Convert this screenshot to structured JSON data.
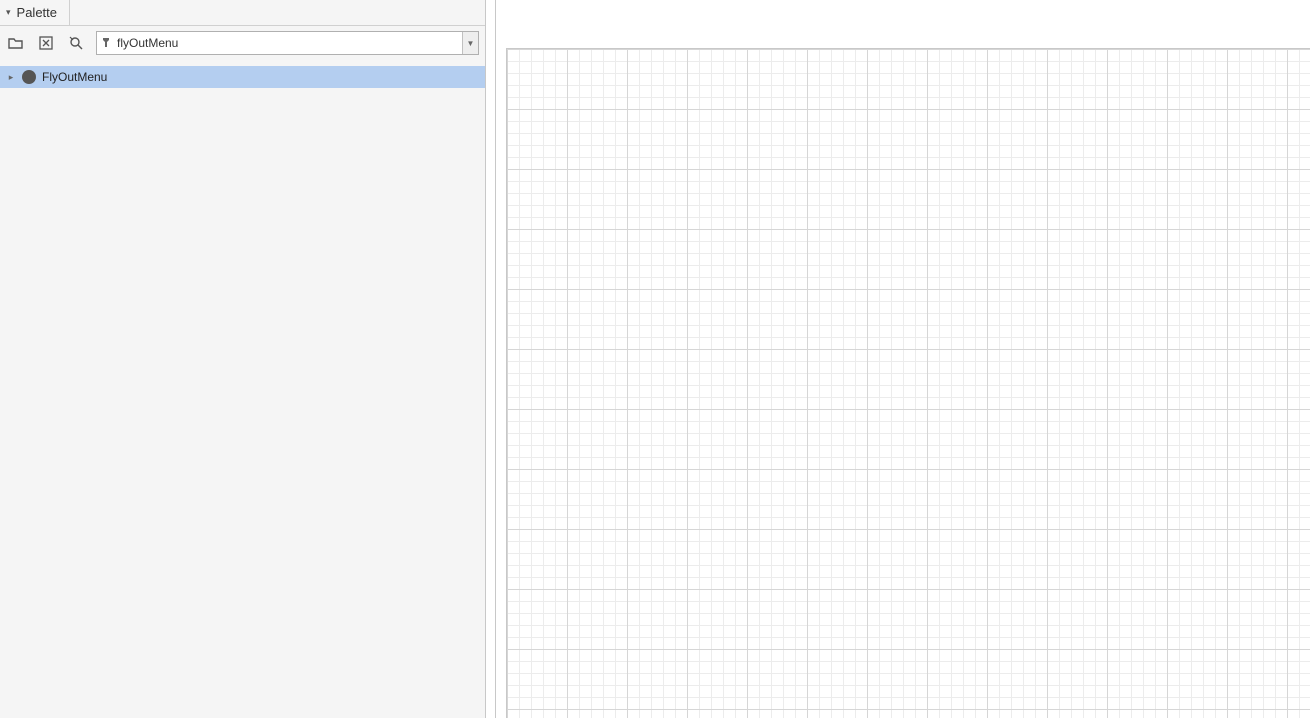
{
  "palette": {
    "tab_label": "Palette",
    "search_value": "flyOutMenu",
    "items": [
      {
        "label": "FlyOutMenu",
        "selected": true
      }
    ]
  },
  "icons": {
    "folder_open": "folder-open-icon",
    "clear": "clear-icon",
    "locate": "locate-icon",
    "filter": "filter-icon",
    "dropdown": "chevron-down-icon"
  }
}
